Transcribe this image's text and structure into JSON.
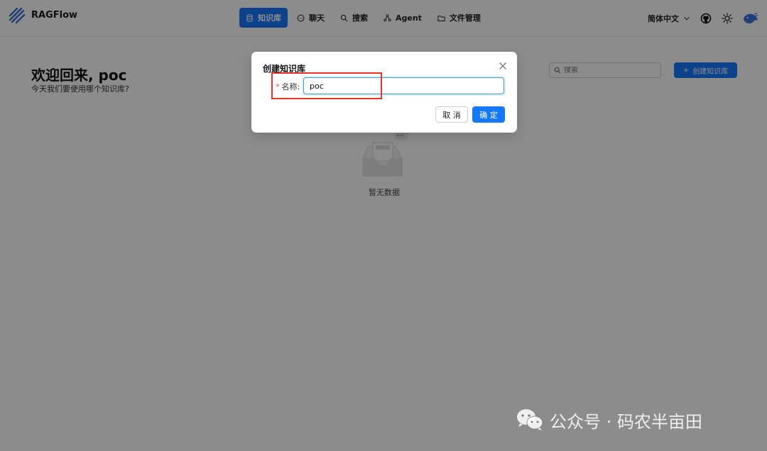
{
  "app": {
    "name": "RAGFlow"
  },
  "nav": [
    {
      "label": "知识库",
      "icon": "database-icon",
      "active": true
    },
    {
      "label": "聊天",
      "icon": "chat-icon",
      "active": false
    },
    {
      "label": "搜索",
      "icon": "search-icon",
      "active": false
    },
    {
      "label": "Agent",
      "icon": "agent-icon",
      "active": false
    },
    {
      "label": "文件管理",
      "icon": "folder-icon",
      "active": false
    }
  ],
  "header": {
    "language": "简体中文"
  },
  "main": {
    "welcome_title": "欢迎回来, poc",
    "welcome_subtitle": "今天我们要使用哪个知识库?",
    "search_placeholder": "搜索",
    "create_button": "创建知识库",
    "empty_text": "暂无数据"
  },
  "modal": {
    "title": "创建知识库",
    "required_mark": "*",
    "name_label": "名称:",
    "name_value": "poc",
    "cancel_label": "取 消",
    "ok_label": "确 定"
  },
  "watermark": {
    "text": "公众号 · 码农半亩田"
  },
  "colors": {
    "primary": "#1677ff",
    "highlight": "#e8312a",
    "required": "#ff4d4f"
  }
}
